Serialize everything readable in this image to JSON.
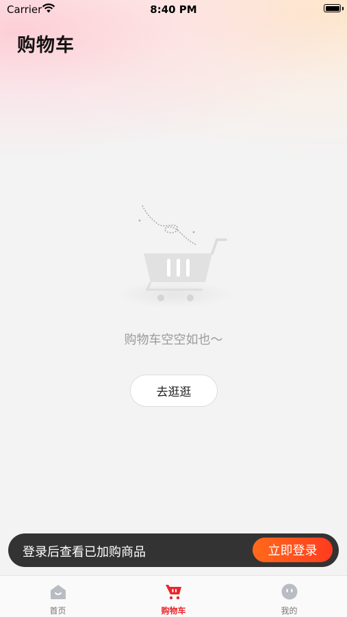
{
  "status_bar": {
    "carrier": "Carrier",
    "time": "8:40 PM"
  },
  "header": {
    "title": "购物车"
  },
  "empty_state": {
    "message": "购物车空空如也～",
    "button_label": "去逛逛"
  },
  "login_banner": {
    "text": "登录后查看已加购商品",
    "button_label": "立即登录"
  },
  "tabs": [
    {
      "label": "首页",
      "icon": "home-icon",
      "active": false
    },
    {
      "label": "购物车",
      "icon": "cart-icon",
      "active": true
    },
    {
      "label": "我的",
      "icon": "profile-icon",
      "active": false
    }
  ],
  "colors": {
    "accent": "#e8272c",
    "login_button": "#ff4a1f",
    "banner_bg": "#333333"
  }
}
